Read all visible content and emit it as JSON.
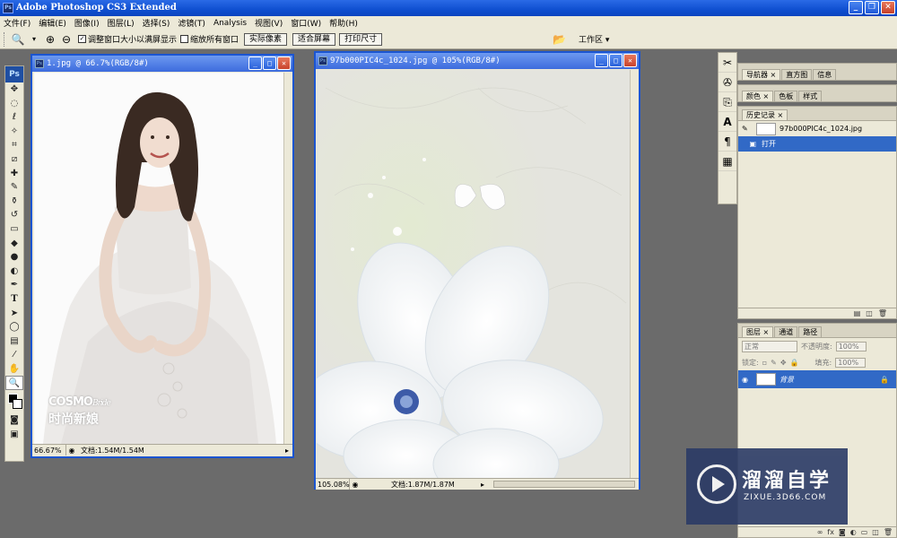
{
  "app": {
    "title": "Adobe Photoshop CS3 Extended",
    "icon": "Ps"
  },
  "menu": [
    "文件(F)",
    "编辑(E)",
    "图像(I)",
    "图层(L)",
    "选择(S)",
    "滤镜(T)",
    "Analysis",
    "视图(V)",
    "窗口(W)",
    "帮助(H)"
  ],
  "options": {
    "resize_windows": "调整窗口大小以满屏显示",
    "zoom_all": "缩放所有窗口",
    "actual_pixels": "实际像素",
    "fit_screen": "适合屏幕",
    "print_size": "打印尺寸",
    "workspace": "工作区 ▾"
  },
  "doc1": {
    "title": "1.jpg @ 66.7%(RGB/8#)",
    "zoom": "66.67%",
    "docsize": "文档:1.54M/1.54M",
    "brand1": "COSMO",
    "brand2": "Bride",
    "brand3": "时尚新娘"
  },
  "doc2": {
    "title": "97b000PIC4c_1024.jpg @ 105%(RGB/8#)",
    "zoom": "105.08%",
    "docsize": "文档:1.87M/1.87M"
  },
  "panels": {
    "nav_tabs": [
      "导航器 ×",
      "直方图",
      "信息"
    ],
    "color_tabs": [
      "颜色 ×",
      "色板",
      "样式"
    ],
    "history_tab": "历史记录 ×",
    "history_file": "97b000PIC4c_1024.jpg",
    "history_step": "打开",
    "layers_tabs": [
      "图层 ×",
      "通道",
      "路径"
    ],
    "blend": "正常",
    "opacity_label": "不透明度:",
    "opacity": "100%",
    "lock_label": "锁定:",
    "fill_label": "填充:",
    "fill": "100%",
    "layer_name": "背景"
  },
  "watermark": {
    "name": "溜溜自学",
    "url": "ZIXUE.3D66.COM"
  }
}
